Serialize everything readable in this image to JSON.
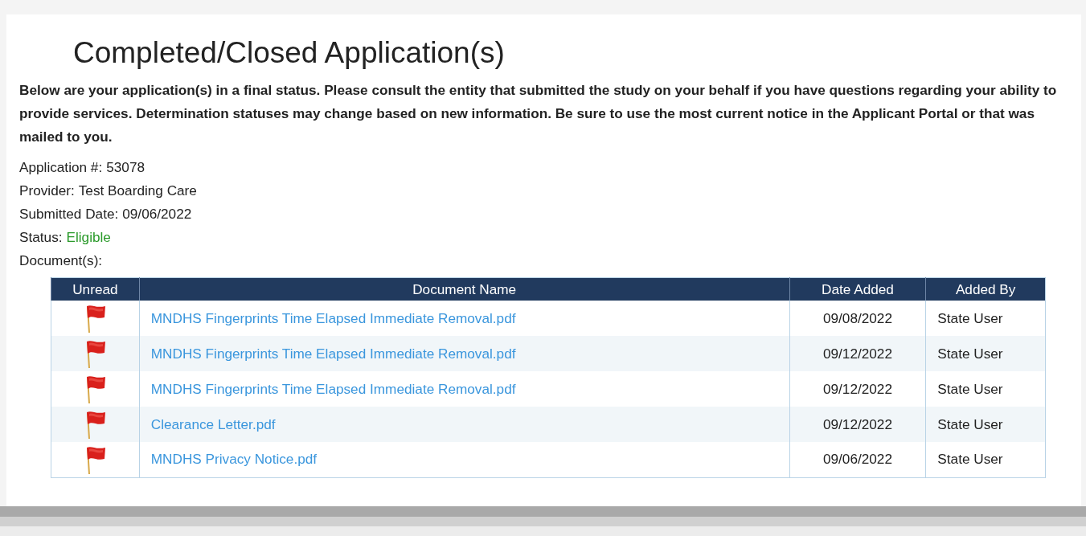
{
  "title": "Completed/Closed Application(s)",
  "intro": "Below are your application(s) in a final status. Please consult the entity that submitted the study on your behalf if you have questions regarding your ability to provide services. Determination statuses may change based on new information. Be sure to use the most current notice in the Applicant Portal or that was mailed to you.",
  "details": [
    {
      "label": "Application #:",
      "value": "53078"
    },
    {
      "label": "Provider:",
      "value": "Test Boarding Care"
    },
    {
      "label": "Submitted Date:",
      "value": "09/06/2022"
    },
    {
      "label": "Status:",
      "value": "Eligible",
      "kind": "status"
    },
    {
      "label": "Document(s):"
    }
  ],
  "table": {
    "columns": [
      "Unread",
      "Document Name",
      "Date Added",
      "Added By"
    ],
    "rows": [
      {
        "unread": true,
        "name": "MNDHS Fingerprints Time Elapsed Immediate Removal.pdf",
        "date": "09/08/2022",
        "added_by": "State User"
      },
      {
        "unread": true,
        "name": "MNDHS Fingerprints Time Elapsed Immediate Removal.pdf",
        "date": "09/12/2022",
        "added_by": "State User"
      },
      {
        "unread": true,
        "name": "MNDHS Fingerprints Time Elapsed Immediate Removal.pdf",
        "date": "09/12/2022",
        "added_by": "State User"
      },
      {
        "unread": true,
        "name": "Clearance Letter.pdf",
        "date": "09/12/2022",
        "added_by": "State User"
      },
      {
        "unread": true,
        "name": "MNDHS Privacy Notice.pdf",
        "date": "09/06/2022",
        "added_by": "State User"
      }
    ]
  }
}
